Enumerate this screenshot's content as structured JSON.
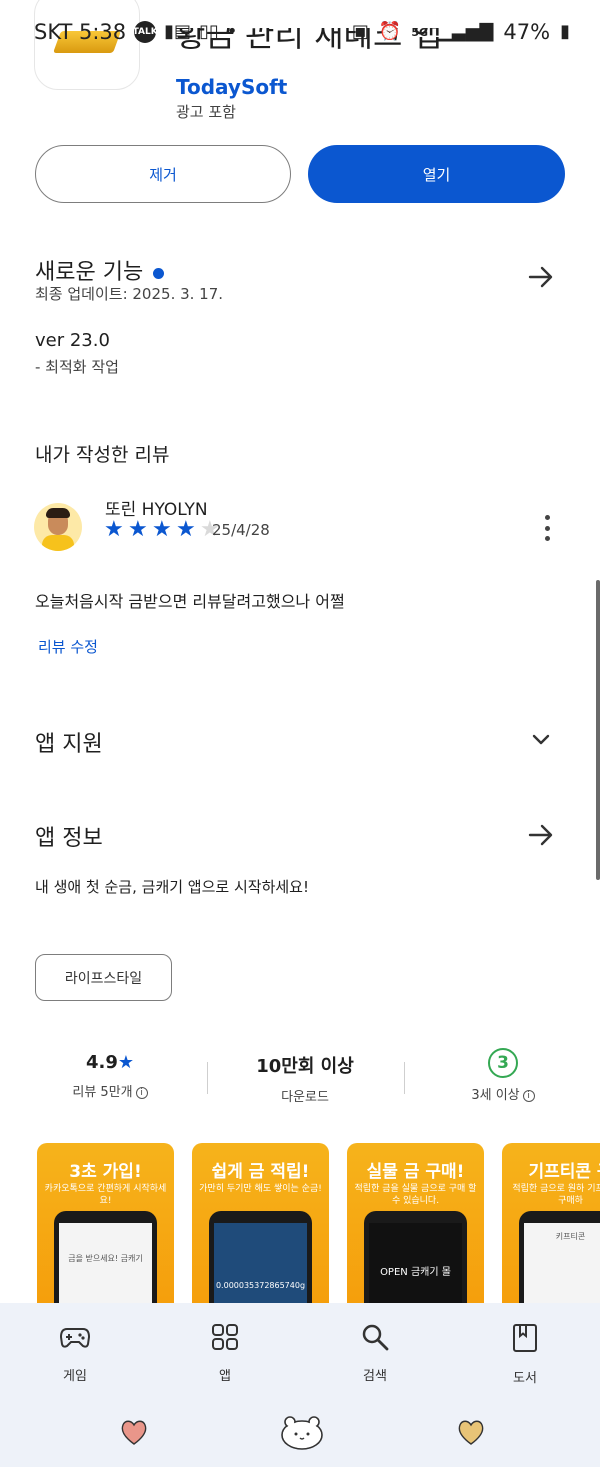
{
  "status_bar": {
    "carrier_time": "SKT 5:38",
    "talk_badge": "TALK",
    "battery": "47%",
    "network": "5G"
  },
  "app": {
    "title_fragment": "황금 관리 재테크 앱",
    "developer": "TodaySoft",
    "ad_note": "광고 포함"
  },
  "actions": {
    "remove_label": "제거",
    "open_label": "열기"
  },
  "whats_new": {
    "title": "새로운 기능",
    "updated": "최종 업데이트: 2025. 3. 17.",
    "version": "ver 23.0",
    "changes": "- 최적화 작업"
  },
  "my_review": {
    "section_title": "내가 작성한 리뷰",
    "reviewer": "또린 HYOLYN",
    "rating": 4,
    "rating_max": 5,
    "date": "25/4/28",
    "text": "오늘처음시작 금받으면 리뷰달려고했으나 어쩔",
    "edit_label": "리뷰 수정"
  },
  "app_support": {
    "title": "앱 지원"
  },
  "about": {
    "title": "앱 정보",
    "description": "내 생애 첫 순금, 금캐기 앱으로 시작하세요!",
    "category_chip": "라이프스타일"
  },
  "stats": {
    "rating_value": "4.9",
    "rating_label": "리뷰 5만개",
    "downloads_value": "10만회 이상",
    "downloads_label": "다운로드",
    "age_value": "3",
    "age_label": "3세 이상"
  },
  "screenshots": [
    {
      "headline": "3초 가입!",
      "sub": "카카오톡으로 간편하게 시작하세요!",
      "screen_text": "금을 받으세요! 금캐기"
    },
    {
      "headline": "쉽게 금 적립!",
      "sub": "가만히 두기만 해도 쌓이는 순금!",
      "screen_text": "0.000035372865740g"
    },
    {
      "headline": "실물 금 구매!",
      "sub": "적립한 금을 실물 금으로 구매 할 수 있습니다.",
      "screen_text": "OPEN 금캐기 몰"
    },
    {
      "headline": "기프티콘 구",
      "sub": "적립한 금으로 원하 기프티콘을 구매하",
      "screen_text": "키프티콘"
    }
  ],
  "bottom_nav": {
    "items": [
      {
        "label": "게임",
        "icon": "gamepad-icon"
      },
      {
        "label": "앱",
        "icon": "apps-grid-icon"
      },
      {
        "label": "검색",
        "icon": "search-icon"
      },
      {
        "label": "도서",
        "icon": "book-icon"
      }
    ]
  },
  "colors": {
    "accent": "#0b57d0",
    "age_badge": "#34a853",
    "nav_bg": "#eef2f9"
  }
}
